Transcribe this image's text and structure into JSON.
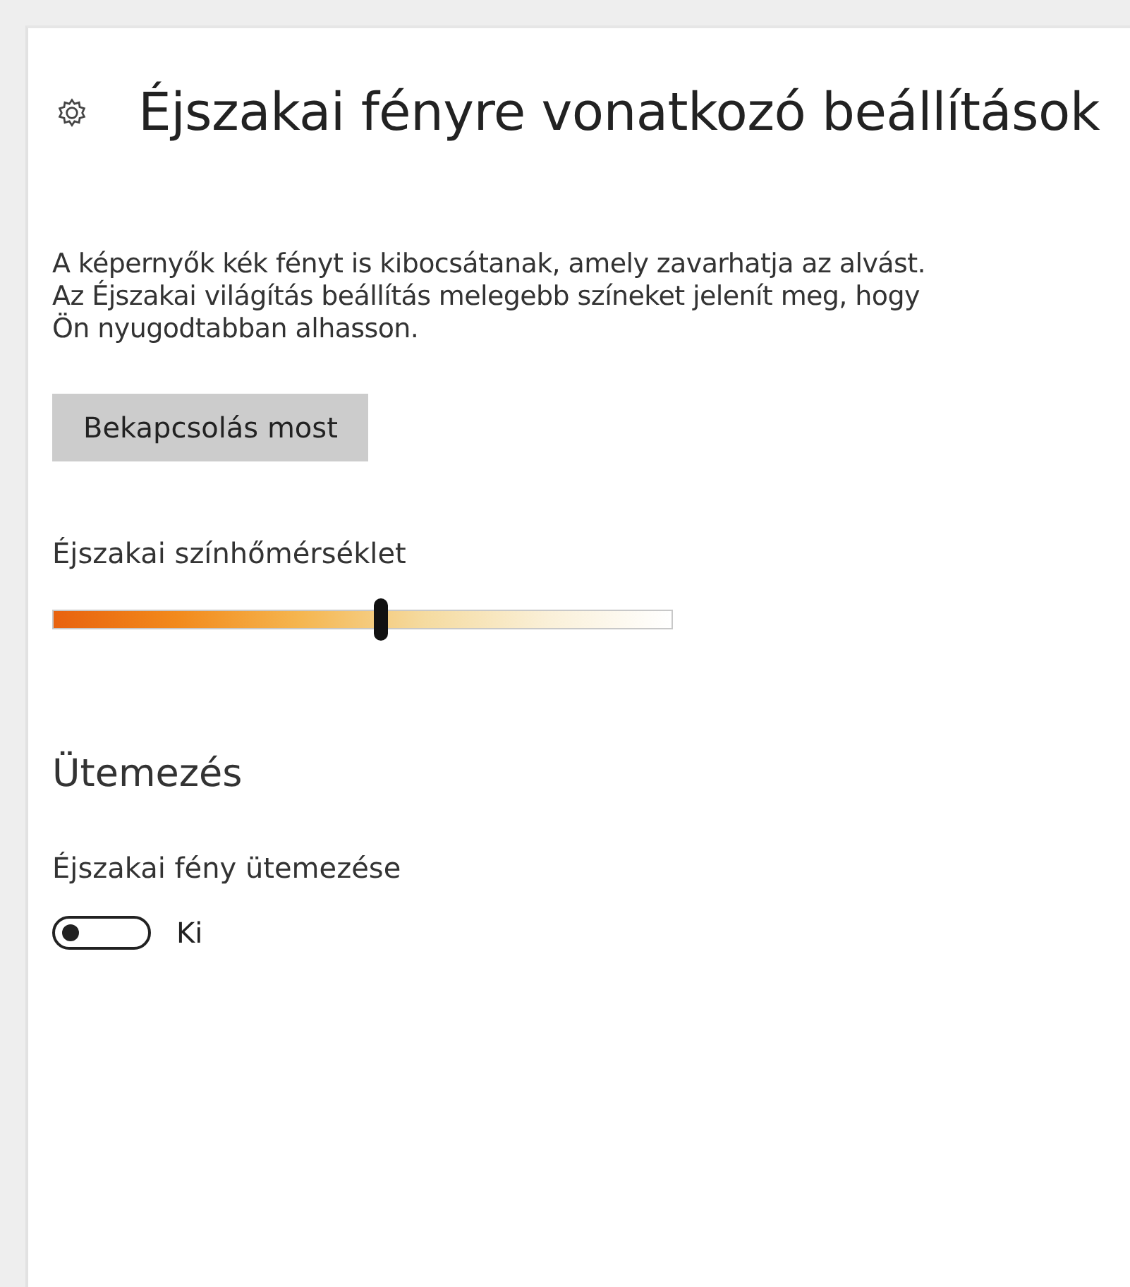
{
  "title": "Éjszakai fényre vonatkozó beállítások",
  "description_lines": [
    "A képernyők kék fényt is kibocsátanak, amely zavarhatja az alvást.",
    "Az Éjszakai világítás beállítás melegebb színeket jelenít meg, hogy",
    "Ön nyugodtabban alhasson."
  ],
  "turn_on_button": "Bekapcsolás most",
  "color_temperature": {
    "label": "Éjszakai színhőmérséklet",
    "level": 0.53
  },
  "schedule": {
    "heading": "Ütemezés",
    "label": "Éjszakai fény ütemezése",
    "toggle": {
      "on": false,
      "state_text": "Ki"
    }
  }
}
